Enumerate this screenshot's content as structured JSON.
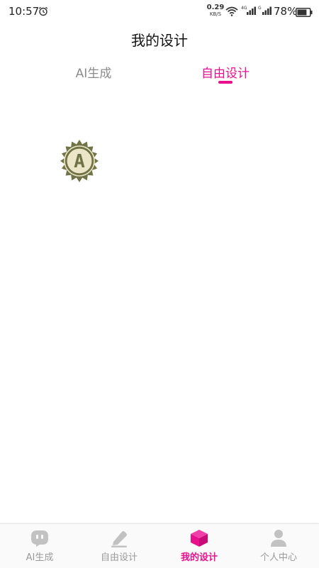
{
  "status_bar": {
    "time": "10:57",
    "net_speed_value": "0.29",
    "net_speed_unit": "KB/S",
    "sig1_label": "4G",
    "sig2_label": "G",
    "battery_text": "78%",
    "battery_level": 0.78
  },
  "header": {
    "title": "我的设计"
  },
  "tabs": [
    {
      "label": "AI生成",
      "active": false
    },
    {
      "label": "自由设计",
      "active": true
    }
  ],
  "designs": [
    {
      "letter": "A",
      "badge_color": "#6f7345",
      "inner_color": "#ece6c8"
    }
  ],
  "bottom_nav": [
    {
      "label": "AI生成",
      "icon": "robot-icon",
      "active": false
    },
    {
      "label": "自由设计",
      "icon": "pencil-icon",
      "active": false
    },
    {
      "label": "我的设计",
      "icon": "cube-icon",
      "active": true
    },
    {
      "label": "个人中心",
      "icon": "user-icon",
      "active": false
    }
  ],
  "colors": {
    "accent": "#e8108c",
    "inactive": "#9a9a9a",
    "icon_inactive": "#c2c2c2"
  }
}
